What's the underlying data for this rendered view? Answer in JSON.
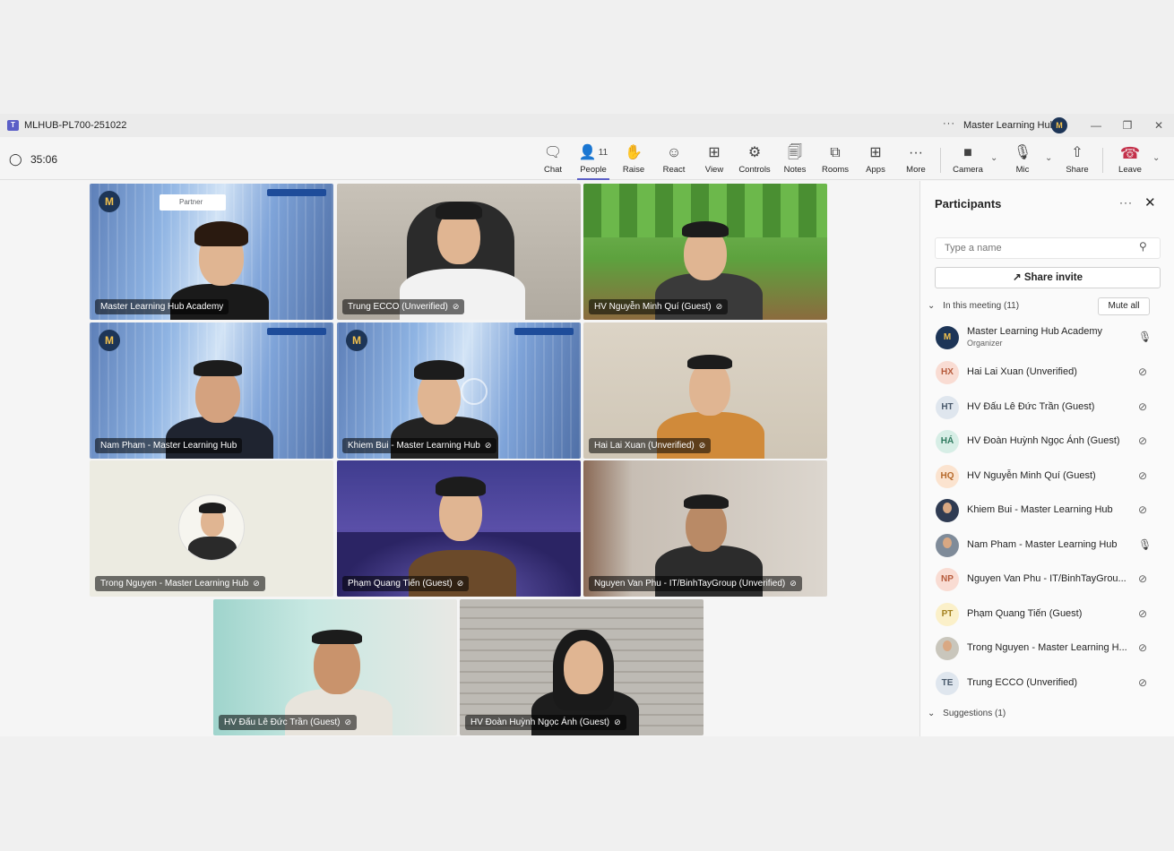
{
  "window": {
    "title": "MLHUB-PL700-251022",
    "org_name": "Master Learning Hub",
    "org_avatar_letter": "M",
    "more_glyph": "···"
  },
  "toolbar": {
    "timer": "35:06",
    "people_count": "11",
    "buttons": {
      "chat": "Chat",
      "people": "People",
      "raise": "Raise",
      "react": "React",
      "view": "View",
      "controls": "Controls",
      "notes": "Notes",
      "rooms": "Rooms",
      "apps": "Apps",
      "more": "More",
      "camera": "Camera",
      "mic": "Mic",
      "share": "Share",
      "leave": "Leave"
    }
  },
  "stage": {
    "tiles": [
      {
        "name": "Master Learning Hub Academy"
      },
      {
        "name": "Trung ECCO (Unverified)"
      },
      {
        "name": "HV Nguyễn Minh Quí (Guest)"
      },
      {
        "name": "Nam Pham - Master Learning Hub"
      },
      {
        "name": "Khiem Bui - Master Learning Hub"
      },
      {
        "name": "Hai Lai Xuan (Unverified)"
      },
      {
        "name": "Trong Nguyen - Master Learning Hub"
      },
      {
        "name": "Phạm Quang Tiến (Guest)"
      },
      {
        "name": "Nguyen Van Phu - IT/BinhTayGroup (Unverified)"
      },
      {
        "name": "HV Đấu Lê Đức Trần (Guest)"
      },
      {
        "name": "HV Đoàn Huỳnh Ngọc Ánh (Guest)"
      }
    ],
    "badge_text": "Partner",
    "logo_letter": "M"
  },
  "panel": {
    "title": "Participants",
    "more_glyph": "···",
    "search_placeholder": "Type a name",
    "share_invite": "Share invite",
    "in_meeting": "In this meeting (11)",
    "mute_all": "Mute all",
    "suggestions": "Suggestions (1)",
    "participants": [
      {
        "initials": "M",
        "name": "Master Learning Hub Academy",
        "role": "Organizer"
      },
      {
        "initials": "HX",
        "name": "Hai Lai Xuan (Unverified)"
      },
      {
        "initials": "HT",
        "name": "HV Đấu Lê Đức Trần (Guest)"
      },
      {
        "initials": "HÁ",
        "name": "HV Đoàn Huỳnh Ngọc Ánh (Guest)"
      },
      {
        "initials": "HQ",
        "name": "HV Nguyễn Minh Quí (Guest)"
      },
      {
        "initials": "",
        "name": "Khiem Bui - Master Learning Hub"
      },
      {
        "initials": "",
        "name": "Nam Pham - Master Learning Hub"
      },
      {
        "initials": "NP",
        "name": "Nguyen Van Phu - IT/BinhTayGrou..."
      },
      {
        "initials": "PT",
        "name": "Phạm Quang Tiến (Guest)"
      },
      {
        "initials": "",
        "name": "Trong Nguyen - Master Learning H..."
      },
      {
        "initials": "TE",
        "name": "Trung ECCO (Unverified)"
      }
    ]
  },
  "colors": {
    "accent": "#5b5fc7",
    "leave": "#c4314b",
    "stage_bg": "#f5f5f5"
  }
}
